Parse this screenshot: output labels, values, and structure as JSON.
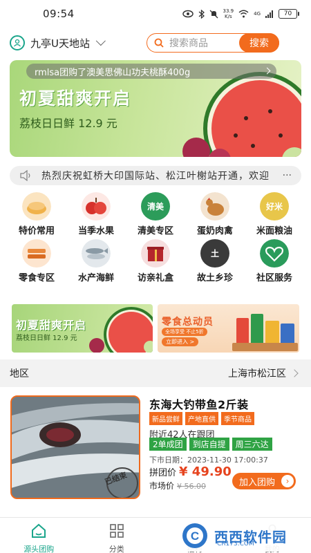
{
  "status_bar": {
    "time": "09:54",
    "net_speed_value": "33.9",
    "net_speed_unit": "K/s",
    "signal": "4G",
    "battery": "70"
  },
  "header": {
    "station": "九亭U天地站",
    "search_placeholder": "搜索商品",
    "search_button": "搜索"
  },
  "hero": {
    "ticker": "rmlsa团购了澳美思佛山功夫桃酥400g",
    "title": "初夏甜爽开启",
    "subtitle": "荔枝日日鲜 12.9 元"
  },
  "notice": {
    "text": "热烈庆祝虹桥大印国际站、松江叶榭站开通，欢迎"
  },
  "categories": [
    {
      "label": "特价常用",
      "icon": "bread-icon",
      "color": "#f0b24a"
    },
    {
      "label": "当季水果",
      "icon": "apple-icon",
      "color": "#d6312b"
    },
    {
      "label": "清美专区",
      "icon": "qingmei-logo-icon",
      "color": "#2c9c5a",
      "logo_text": "清美"
    },
    {
      "label": "蛋奶肉禽",
      "icon": "chicken-icon",
      "color": "#c9823a"
    },
    {
      "label": "米面粮油",
      "icon": "rice-icon",
      "color": "#e8c64a",
      "logo_text": "好米"
    },
    {
      "label": "零食专区",
      "icon": "snack-icon",
      "color": "#e8873a"
    },
    {
      "label": "水产海鲜",
      "icon": "fish-icon",
      "color": "#8a9aa5"
    },
    {
      "label": "访亲礼盒",
      "icon": "gift-box-icon",
      "color": "#b5272d"
    },
    {
      "label": "故土乡珍",
      "icon": "local-specialty-icon",
      "color": "#3a3a3a",
      "logo_text": "土"
    },
    {
      "label": "社区服务",
      "icon": "community-service-icon",
      "color": "#2a9b5b"
    }
  ],
  "promo_left": {
    "title": "初夏甜爽开启",
    "subtitle": "荔枝日日鲜 12.9 元"
  },
  "promo_right": {
    "title": "零食总动员",
    "tag": "全场享受 不止5折",
    "button": "立即进入 >"
  },
  "region": {
    "label": "地区",
    "value": "上海市松江区"
  },
  "product": {
    "title": "东海大钓带鱼2斤装",
    "tags": [
      "新品尝鲜",
      "产地直供",
      "季节商品"
    ],
    "followers": "附近42人在跟团",
    "delivery_tags": [
      "2单成团",
      "到店自提",
      "周三六达"
    ],
    "deadline_label": "下市日期：",
    "deadline_value": "2023-11-30 17:00:37",
    "price_label": "拼团价",
    "price_value": "¥ 49.90",
    "market_label": "市场价",
    "market_value": "¥ 56.00",
    "join_button": "加入团购",
    "stamp": "已结束"
  },
  "bottom_nav": [
    {
      "label": "源头团购",
      "icon": "home-icon",
      "active": true
    },
    {
      "label": "分类",
      "icon": "grid-icon",
      "active": false
    },
    {
      "label": "福利",
      "icon": "gift-icon",
      "active": false
    },
    {
      "label": "我的",
      "icon": "user-icon",
      "active": false
    }
  ],
  "watermark": {
    "text": "西西软件园",
    "sub": "CR173.COM",
    "logo_letter": "C"
  },
  "colors": {
    "accent_orange": "#f26b1d",
    "accent_green": "#1aa58b",
    "tag_green": "#2fa344",
    "price_red": "#e6431e"
  }
}
